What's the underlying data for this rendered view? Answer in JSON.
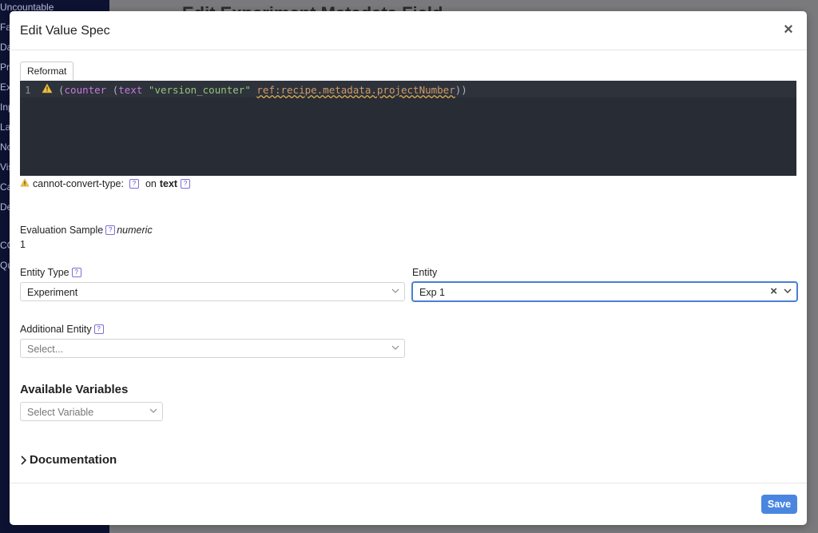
{
  "background": {
    "sidebar_items": [
      "Uncountable",
      "Fav",
      "Da",
      "Pro",
      "Exp",
      "Inp",
      "Lab",
      "No",
      "Vis",
      "Ca",
      "De",
      "CO",
      "Qu"
    ],
    "page_title": "Edit Experiment Metadata Field"
  },
  "modal": {
    "title": "Edit Value Spec",
    "close_icon": "×",
    "reformat_label": "Reformat",
    "editor": {
      "line_number": "1",
      "code_tokens": {
        "open1": "(",
        "counter": "counter",
        "open2": " (",
        "text_kw": "text",
        "str": "\"version_counter\"",
        "ref": "ref:recipe.metadata.projectNumber",
        "close": "))"
      }
    },
    "diagnostic": {
      "code": "cannot-convert-type:",
      "on_label": "on",
      "target": "text"
    },
    "evaluation": {
      "label": "Evaluation Sample",
      "type": "numeric",
      "value": "1"
    },
    "entity_type": {
      "label": "Entity Type",
      "value": "Experiment"
    },
    "entity": {
      "label": "Entity",
      "value": "Exp 1"
    },
    "additional_entity": {
      "label": "Additional Entity",
      "placeholder": "Select..."
    },
    "available_variables": {
      "title": "Available Variables",
      "placeholder": "Select Variable"
    },
    "documentation": {
      "label": "Documentation"
    },
    "save_label": "Save"
  },
  "colors": {
    "accent": "#4a86e0",
    "editor_bg": "#282c34",
    "warning": "#f0c040"
  },
  "icons": {
    "help": "?",
    "warning": "warning-triangle-icon",
    "chevron": "chevron-down-icon"
  }
}
